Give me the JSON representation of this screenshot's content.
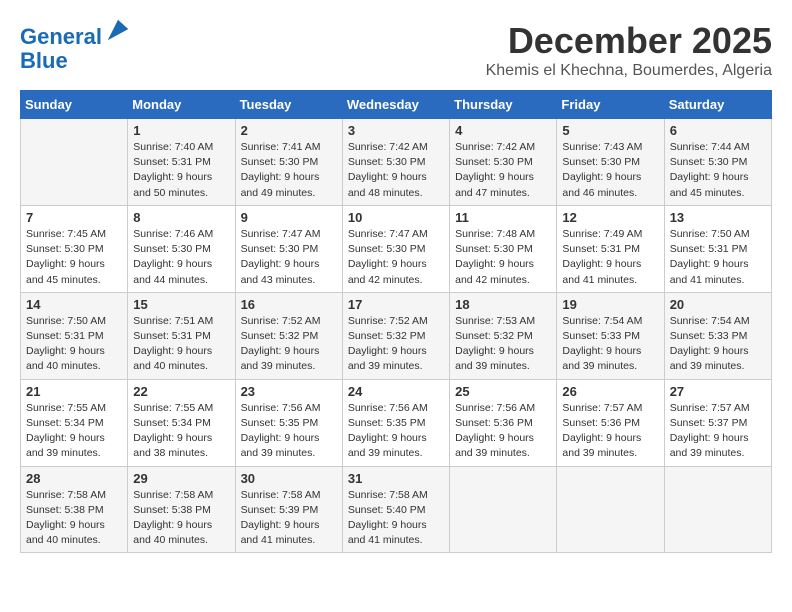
{
  "logo": {
    "line1": "General",
    "line2": "Blue"
  },
  "title": "December 2025",
  "subtitle": "Khemis el Khechna, Boumerdes, Algeria",
  "weekdays": [
    "Sunday",
    "Monday",
    "Tuesday",
    "Wednesday",
    "Thursday",
    "Friday",
    "Saturday"
  ],
  "weeks": [
    [
      {
        "day": "",
        "info": ""
      },
      {
        "day": "1",
        "info": "Sunrise: 7:40 AM\nSunset: 5:31 PM\nDaylight: 9 hours\nand 50 minutes."
      },
      {
        "day": "2",
        "info": "Sunrise: 7:41 AM\nSunset: 5:30 PM\nDaylight: 9 hours\nand 49 minutes."
      },
      {
        "day": "3",
        "info": "Sunrise: 7:42 AM\nSunset: 5:30 PM\nDaylight: 9 hours\nand 48 minutes."
      },
      {
        "day": "4",
        "info": "Sunrise: 7:42 AM\nSunset: 5:30 PM\nDaylight: 9 hours\nand 47 minutes."
      },
      {
        "day": "5",
        "info": "Sunrise: 7:43 AM\nSunset: 5:30 PM\nDaylight: 9 hours\nand 46 minutes."
      },
      {
        "day": "6",
        "info": "Sunrise: 7:44 AM\nSunset: 5:30 PM\nDaylight: 9 hours\nand 45 minutes."
      }
    ],
    [
      {
        "day": "7",
        "info": "Sunrise: 7:45 AM\nSunset: 5:30 PM\nDaylight: 9 hours\nand 45 minutes."
      },
      {
        "day": "8",
        "info": "Sunrise: 7:46 AM\nSunset: 5:30 PM\nDaylight: 9 hours\nand 44 minutes."
      },
      {
        "day": "9",
        "info": "Sunrise: 7:47 AM\nSunset: 5:30 PM\nDaylight: 9 hours\nand 43 minutes."
      },
      {
        "day": "10",
        "info": "Sunrise: 7:47 AM\nSunset: 5:30 PM\nDaylight: 9 hours\nand 42 minutes."
      },
      {
        "day": "11",
        "info": "Sunrise: 7:48 AM\nSunset: 5:30 PM\nDaylight: 9 hours\nand 42 minutes."
      },
      {
        "day": "12",
        "info": "Sunrise: 7:49 AM\nSunset: 5:31 PM\nDaylight: 9 hours\nand 41 minutes."
      },
      {
        "day": "13",
        "info": "Sunrise: 7:50 AM\nSunset: 5:31 PM\nDaylight: 9 hours\nand 41 minutes."
      }
    ],
    [
      {
        "day": "14",
        "info": "Sunrise: 7:50 AM\nSunset: 5:31 PM\nDaylight: 9 hours\nand 40 minutes."
      },
      {
        "day": "15",
        "info": "Sunrise: 7:51 AM\nSunset: 5:31 PM\nDaylight: 9 hours\nand 40 minutes."
      },
      {
        "day": "16",
        "info": "Sunrise: 7:52 AM\nSunset: 5:32 PM\nDaylight: 9 hours\nand 39 minutes."
      },
      {
        "day": "17",
        "info": "Sunrise: 7:52 AM\nSunset: 5:32 PM\nDaylight: 9 hours\nand 39 minutes."
      },
      {
        "day": "18",
        "info": "Sunrise: 7:53 AM\nSunset: 5:32 PM\nDaylight: 9 hours\nand 39 minutes."
      },
      {
        "day": "19",
        "info": "Sunrise: 7:54 AM\nSunset: 5:33 PM\nDaylight: 9 hours\nand 39 minutes."
      },
      {
        "day": "20",
        "info": "Sunrise: 7:54 AM\nSunset: 5:33 PM\nDaylight: 9 hours\nand 39 minutes."
      }
    ],
    [
      {
        "day": "21",
        "info": "Sunrise: 7:55 AM\nSunset: 5:34 PM\nDaylight: 9 hours\nand 39 minutes."
      },
      {
        "day": "22",
        "info": "Sunrise: 7:55 AM\nSunset: 5:34 PM\nDaylight: 9 hours\nand 38 minutes."
      },
      {
        "day": "23",
        "info": "Sunrise: 7:56 AM\nSunset: 5:35 PM\nDaylight: 9 hours\nand 39 minutes."
      },
      {
        "day": "24",
        "info": "Sunrise: 7:56 AM\nSunset: 5:35 PM\nDaylight: 9 hours\nand 39 minutes."
      },
      {
        "day": "25",
        "info": "Sunrise: 7:56 AM\nSunset: 5:36 PM\nDaylight: 9 hours\nand 39 minutes."
      },
      {
        "day": "26",
        "info": "Sunrise: 7:57 AM\nSunset: 5:36 PM\nDaylight: 9 hours\nand 39 minutes."
      },
      {
        "day": "27",
        "info": "Sunrise: 7:57 AM\nSunset: 5:37 PM\nDaylight: 9 hours\nand 39 minutes."
      }
    ],
    [
      {
        "day": "28",
        "info": "Sunrise: 7:58 AM\nSunset: 5:38 PM\nDaylight: 9 hours\nand 40 minutes."
      },
      {
        "day": "29",
        "info": "Sunrise: 7:58 AM\nSunset: 5:38 PM\nDaylight: 9 hours\nand 40 minutes."
      },
      {
        "day": "30",
        "info": "Sunrise: 7:58 AM\nSunset: 5:39 PM\nDaylight: 9 hours\nand 41 minutes."
      },
      {
        "day": "31",
        "info": "Sunrise: 7:58 AM\nSunset: 5:40 PM\nDaylight: 9 hours\nand 41 minutes."
      },
      {
        "day": "",
        "info": ""
      },
      {
        "day": "",
        "info": ""
      },
      {
        "day": "",
        "info": ""
      }
    ]
  ]
}
